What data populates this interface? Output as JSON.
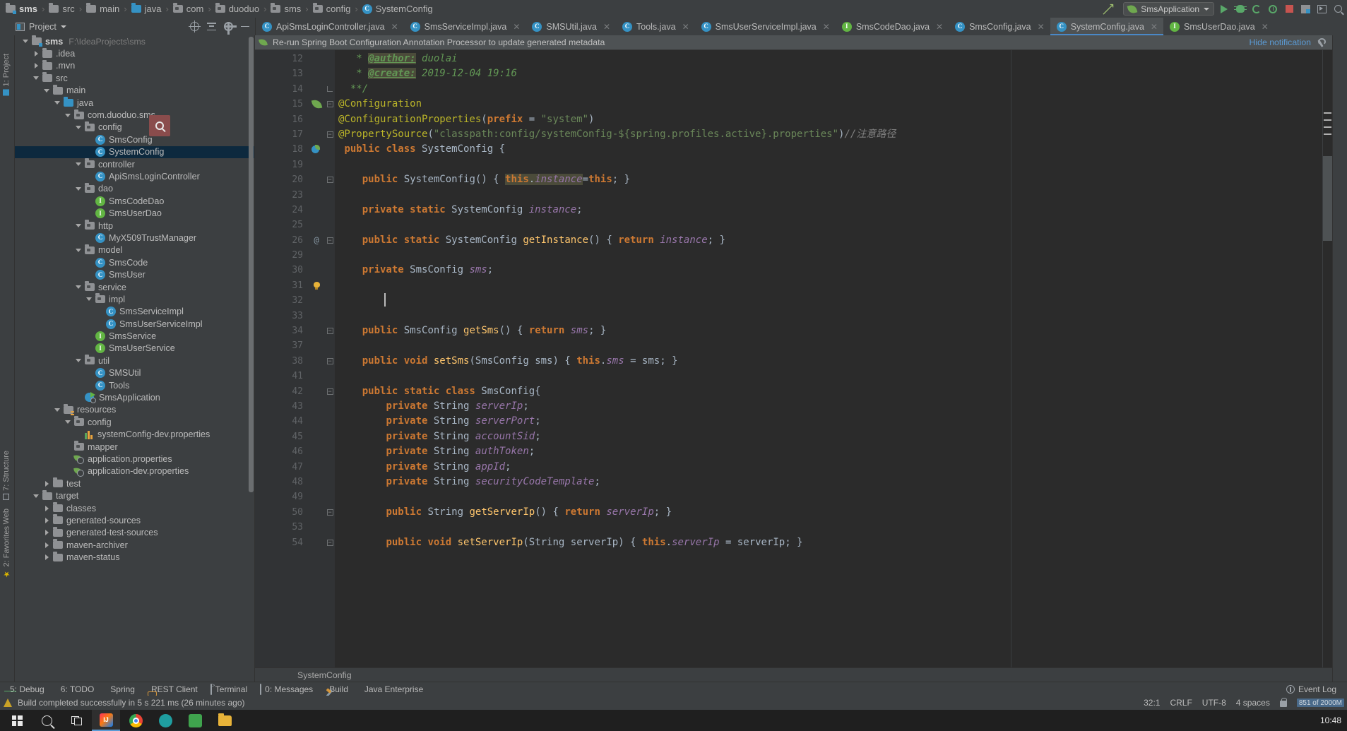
{
  "breadcrumbs": [
    {
      "label": "sms",
      "icon": "folder-module-icon"
    },
    {
      "label": "src",
      "icon": "folder-icon"
    },
    {
      "label": "main",
      "icon": "folder-icon"
    },
    {
      "label": "java",
      "icon": "folder-source-icon"
    },
    {
      "label": "com",
      "icon": "package-icon"
    },
    {
      "label": "duoduo",
      "icon": "package-icon"
    },
    {
      "label": "sms",
      "icon": "package-icon"
    },
    {
      "label": "config",
      "icon": "package-icon"
    },
    {
      "label": "SystemConfig",
      "icon": "class-icon"
    }
  ],
  "run_config": {
    "name": "SmsApplication",
    "icons": [
      "run-icon",
      "debug-icon",
      "coverage-icon",
      "profile-icon",
      "stop-icon",
      "layout-icon",
      "window-icon",
      "search-everywhere-icon"
    ]
  },
  "project_panel": {
    "title": "Project",
    "toolbar_icons": [
      "locate-icon",
      "collapse-all-icon",
      "gear-icon",
      "hide-icon"
    ]
  },
  "tabs": [
    {
      "label": "ApiSmsLoginController.java",
      "icon": "class-icon",
      "active": false
    },
    {
      "label": "SmsServiceImpl.java",
      "icon": "class-icon",
      "active": false
    },
    {
      "label": "SMSUtil.java",
      "icon": "class-icon",
      "active": false
    },
    {
      "label": "Tools.java",
      "icon": "class-icon",
      "active": false
    },
    {
      "label": "SmsUserServiceImpl.java",
      "icon": "class-icon",
      "active": false
    },
    {
      "label": "SmsCodeDao.java",
      "icon": "interface-icon",
      "active": false
    },
    {
      "label": "SmsConfig.java",
      "icon": "class-icon",
      "active": false
    },
    {
      "label": "SystemConfig.java",
      "icon": "class-icon",
      "active": true
    },
    {
      "label": "SmsUserDao.java",
      "icon": "interface-icon",
      "active": false
    }
  ],
  "notification": {
    "text": "Re-run Spring Boot Configuration Annotation Processor to update generated metadata",
    "action": "Hide notification",
    "icon": "spring-leaf-icon"
  },
  "tree": [
    {
      "depth": 0,
      "label": "sms",
      "path": "F:\\IdeaProjects\\sms",
      "icon": "module-icon",
      "arrow": "open",
      "bold": true
    },
    {
      "depth": 1,
      "label": ".idea",
      "icon": "folder-icon",
      "arrow": "closed"
    },
    {
      "depth": 1,
      "label": ".mvn",
      "icon": "folder-icon",
      "arrow": "closed"
    },
    {
      "depth": 1,
      "label": "src",
      "icon": "folder-icon",
      "arrow": "open"
    },
    {
      "depth": 2,
      "label": "main",
      "icon": "folder-icon",
      "arrow": "open"
    },
    {
      "depth": 3,
      "label": "java",
      "icon": "folder-source-icon",
      "arrow": "open"
    },
    {
      "depth": 4,
      "label": "com.duoduo.sms",
      "icon": "package-icon",
      "arrow": "open"
    },
    {
      "depth": 5,
      "label": "config",
      "icon": "package-icon",
      "arrow": "open"
    },
    {
      "depth": 6,
      "label": "SmsConfig",
      "icon": "class-icon"
    },
    {
      "depth": 6,
      "label": "SystemConfig",
      "icon": "class-icon",
      "selected": true
    },
    {
      "depth": 5,
      "label": "controller",
      "icon": "package-icon",
      "arrow": "open"
    },
    {
      "depth": 6,
      "label": "ApiSmsLoginController",
      "icon": "class-icon"
    },
    {
      "depth": 5,
      "label": "dao",
      "icon": "package-icon",
      "arrow": "open"
    },
    {
      "depth": 6,
      "label": "SmsCodeDao",
      "icon": "interface-icon"
    },
    {
      "depth": 6,
      "label": "SmsUserDao",
      "icon": "interface-icon"
    },
    {
      "depth": 5,
      "label": "http",
      "icon": "package-icon",
      "arrow": "open"
    },
    {
      "depth": 6,
      "label": "MyX509TrustManager",
      "icon": "class-icon"
    },
    {
      "depth": 5,
      "label": "model",
      "icon": "package-icon",
      "arrow": "open"
    },
    {
      "depth": 6,
      "label": "SmsCode",
      "icon": "class-icon"
    },
    {
      "depth": 6,
      "label": "SmsUser",
      "icon": "class-icon"
    },
    {
      "depth": 5,
      "label": "service",
      "icon": "package-icon",
      "arrow": "open"
    },
    {
      "depth": 6,
      "label": "impl",
      "icon": "package-icon",
      "arrow": "open"
    },
    {
      "depth": 7,
      "label": "SmsServiceImpl",
      "icon": "class-icon"
    },
    {
      "depth": 7,
      "label": "SmsUserServiceImpl",
      "icon": "class-icon"
    },
    {
      "depth": 6,
      "label": "SmsService",
      "icon": "interface-icon"
    },
    {
      "depth": 6,
      "label": "SmsUserService",
      "icon": "interface-icon"
    },
    {
      "depth": 5,
      "label": "util",
      "icon": "package-icon",
      "arrow": "open"
    },
    {
      "depth": 6,
      "label": "SMSUtil",
      "icon": "class-icon"
    },
    {
      "depth": 6,
      "label": "Tools",
      "icon": "class-icon"
    },
    {
      "depth": 5,
      "label": "SmsApplication",
      "icon": "spring-class-icon"
    },
    {
      "depth": 3,
      "label": "resources",
      "icon": "folder-resources-icon",
      "arrow": "open"
    },
    {
      "depth": 4,
      "label": "config",
      "icon": "package-icon",
      "arrow": "open"
    },
    {
      "depth": 5,
      "label": "systemConfig-dev.properties",
      "icon": "properties-icon"
    },
    {
      "depth": 4,
      "label": "mapper",
      "icon": "package-icon"
    },
    {
      "depth": 4,
      "label": "application.properties",
      "icon": "spring-properties-icon"
    },
    {
      "depth": 4,
      "label": "application-dev.properties",
      "icon": "spring-properties-icon"
    },
    {
      "depth": 2,
      "label": "test",
      "icon": "folder-icon",
      "arrow": "closed"
    },
    {
      "depth": 1,
      "label": "target",
      "icon": "folder-icon",
      "arrow": "open"
    },
    {
      "depth": 2,
      "label": "classes",
      "icon": "folder-icon",
      "arrow": "closed"
    },
    {
      "depth": 2,
      "label": "generated-sources",
      "icon": "folder-icon",
      "arrow": "closed"
    },
    {
      "depth": 2,
      "label": "generated-test-sources",
      "icon": "folder-icon",
      "arrow": "closed"
    },
    {
      "depth": 2,
      "label": "maven-archiver",
      "icon": "folder-icon",
      "arrow": "closed"
    },
    {
      "depth": 2,
      "label": "maven-status",
      "icon": "folder-icon",
      "arrow": "closed"
    }
  ],
  "left_strips": [
    "1: Project",
    "7: Structure",
    "Web",
    "2: Favorites"
  ],
  "code_lines": [
    {
      "num": "12",
      "mark": "",
      "fold": "",
      "html": "   <span class=\"cmt\">* </span><span class=\"cmt-b\">@author:</span><span class=\"cmt\"> duolai</span>"
    },
    {
      "num": "13",
      "mark": "",
      "fold": "",
      "html": "   <span class=\"cmt\">* </span><span class=\"cmt-b\">@create:</span><span class=\"cmt\"> 2019-12-04 19:16</span>"
    },
    {
      "num": "14",
      "mark": "",
      "fold": "end",
      "html": "  <span class=\"cmt\">**/</span>"
    },
    {
      "num": "15",
      "mark": "spring",
      "fold": "open",
      "html": "<span class=\"ann\">@Configuration</span>"
    },
    {
      "num": "16",
      "mark": "",
      "fold": "",
      "html": "<span class=\"ann\">@ConfigurationProperties</span>(<span class=\"kw\">prefix</span> = <span class=\"str\">\"system\"</span>)"
    },
    {
      "num": "17",
      "mark": "",
      "fold": "open",
      "html": "<span class=\"ann\">@PropertySource</span>(<span class=\"str\">\"classpath:config/systemConfig-${spring.profiles.active}.properties\"</span>)<span class=\"zh\">//注意路径</span>"
    },
    {
      "num": "18",
      "mark": "bean",
      "fold": "",
      "html": " <span class=\"kw\">public class </span><span class=\"cn\">SystemConfig </span>{"
    },
    {
      "num": "19",
      "mark": "",
      "fold": "",
      "html": ""
    },
    {
      "num": "20",
      "mark": "",
      "fold": "open",
      "html": "    <span class=\"kw\">public </span><span class=\"cn\">SystemConfig</span>() { <span class=\"hl\"><span class=\"kw\">this</span>.<span class=\"fld\">instance</span></span>=<span class=\"kw\">this</span>; }"
    },
    {
      "num": "23",
      "mark": "",
      "fold": "",
      "html": ""
    },
    {
      "num": "24",
      "mark": "",
      "fold": "",
      "html": "    <span class=\"kw\">private static </span><span class=\"cn\">SystemConfig </span><span class=\"fld\">instance</span>;"
    },
    {
      "num": "25",
      "mark": "",
      "fold": "",
      "html": ""
    },
    {
      "num": "26",
      "mark": "override",
      "fold": "open",
      "html": "    <span class=\"kw\">public static </span><span class=\"cn\">SystemConfig </span><span class=\"mth\">getInstance</span>() { <span class=\"kw\">return </span><span class=\"fld\">instance</span>; }"
    },
    {
      "num": "29",
      "mark": "",
      "fold": "",
      "html": ""
    },
    {
      "num": "30",
      "mark": "",
      "fold": "",
      "html": "    <span class=\"kw\">private </span><span class=\"cn\">SmsConfig </span><span class=\"fld\">sms</span>;"
    },
    {
      "num": "31",
      "mark": "bulb",
      "fold": "",
      "html": ""
    },
    {
      "num": "32",
      "mark": "caret",
      "fold": "",
      "html": ""
    },
    {
      "num": "33",
      "mark": "",
      "fold": "",
      "html": ""
    },
    {
      "num": "34",
      "mark": "",
      "fold": "open",
      "html": "    <span class=\"kw\">public </span><span class=\"cn\">SmsConfig </span><span class=\"mth\">getSms</span>() { <span class=\"kw\">return </span><span class=\"fld\">sms</span>; }"
    },
    {
      "num": "37",
      "mark": "",
      "fold": "",
      "html": ""
    },
    {
      "num": "38",
      "mark": "",
      "fold": "open",
      "html": "    <span class=\"kw\">public void </span><span class=\"mth\">setSms</span>(<span class=\"cn\">SmsConfig </span>sms) { <span class=\"kw\">this</span>.<span class=\"fld\">sms </span>= sms; }"
    },
    {
      "num": "41",
      "mark": "",
      "fold": "",
      "html": ""
    },
    {
      "num": "42",
      "mark": "",
      "fold": "open",
      "html": "    <span class=\"kw\">public static class </span><span class=\"cn\">SmsConfig</span>{"
    },
    {
      "num": "43",
      "mark": "",
      "fold": "",
      "html": "        <span class=\"kw\">private </span><span class=\"cn\">String </span><span class=\"fld\">serverIp</span>;"
    },
    {
      "num": "44",
      "mark": "",
      "fold": "",
      "html": "        <span class=\"kw\">private </span><span class=\"cn\">String </span><span class=\"fld\">serverPort</span>;"
    },
    {
      "num": "45",
      "mark": "",
      "fold": "",
      "html": "        <span class=\"kw\">private </span><span class=\"cn\">String </span><span class=\"fld\">accountSid</span>;"
    },
    {
      "num": "46",
      "mark": "",
      "fold": "",
      "html": "        <span class=\"kw\">private </span><span class=\"cn\">String </span><span class=\"fld\">authToken</span>;"
    },
    {
      "num": "47",
      "mark": "",
      "fold": "",
      "html": "        <span class=\"kw\">private </span><span class=\"cn\">String </span><span class=\"fld\">appId</span>;"
    },
    {
      "num": "48",
      "mark": "",
      "fold": "",
      "html": "        <span class=\"kw\">private </span><span class=\"cn\">String </span><span class=\"fld\">securityCodeTemplate</span>;"
    },
    {
      "num": "49",
      "mark": "",
      "fold": "",
      "html": ""
    },
    {
      "num": "50",
      "mark": "",
      "fold": "open",
      "html": "        <span class=\"kw\">public </span><span class=\"cn\">String </span><span class=\"mth\">getServerIp</span>() { <span class=\"kw\">return </span><span class=\"fld\">serverIp</span>; }"
    },
    {
      "num": "53",
      "mark": "",
      "fold": "",
      "html": ""
    },
    {
      "num": "54",
      "mark": "",
      "fold": "open",
      "html": "        <span class=\"kw\">public void </span><span class=\"mth\">setServerIp</span>(<span class=\"cn\">String </span>serverIp) { <span class=\"kw\">this</span>.<span class=\"fld\">serverIp </span>= serverIp; }"
    }
  ],
  "editor_breadcrumb": "SystemConfig",
  "bottom_tools": [
    {
      "label": "5: Debug",
      "icon": "debug-icon"
    },
    {
      "label": "6: TODO",
      "icon": "todo-icon"
    },
    {
      "label": "Spring",
      "icon": "spring-leaf-icon"
    },
    {
      "label": "REST Client",
      "icon": "rest-client-icon"
    },
    {
      "label": "Terminal",
      "icon": "terminal-icon"
    },
    {
      "label": "0: Messages",
      "icon": "messages-icon"
    },
    {
      "label": "Build",
      "icon": "build-icon"
    },
    {
      "label": "Java Enterprise",
      "icon": "java-enterprise-icon"
    }
  ],
  "status_bar": {
    "message": "Build completed successfully in 5 s 221 ms (26 minutes ago)",
    "caret_position": "32:1",
    "line_separator": "CRLF",
    "encoding": "UTF-8",
    "indent": "4 spaces",
    "memory": "851 of 2000M",
    "event_log": "Event Log"
  },
  "taskbar": {
    "clock_time": "10:48",
    "items": [
      "start-icon",
      "search-icon",
      "task-view-icon",
      "intellij-icon",
      "chrome-icon",
      "teal-app-icon",
      "green-app-icon",
      "explorer-icon"
    ]
  },
  "colors": {
    "accent_blue": "#4a88c7",
    "selection": "#0d293e",
    "editor_bg": "#2b2b2b",
    "panel_bg": "#3c3f41",
    "gutter_bg": "#313335",
    "link_blue": "#5b9bd5"
  }
}
